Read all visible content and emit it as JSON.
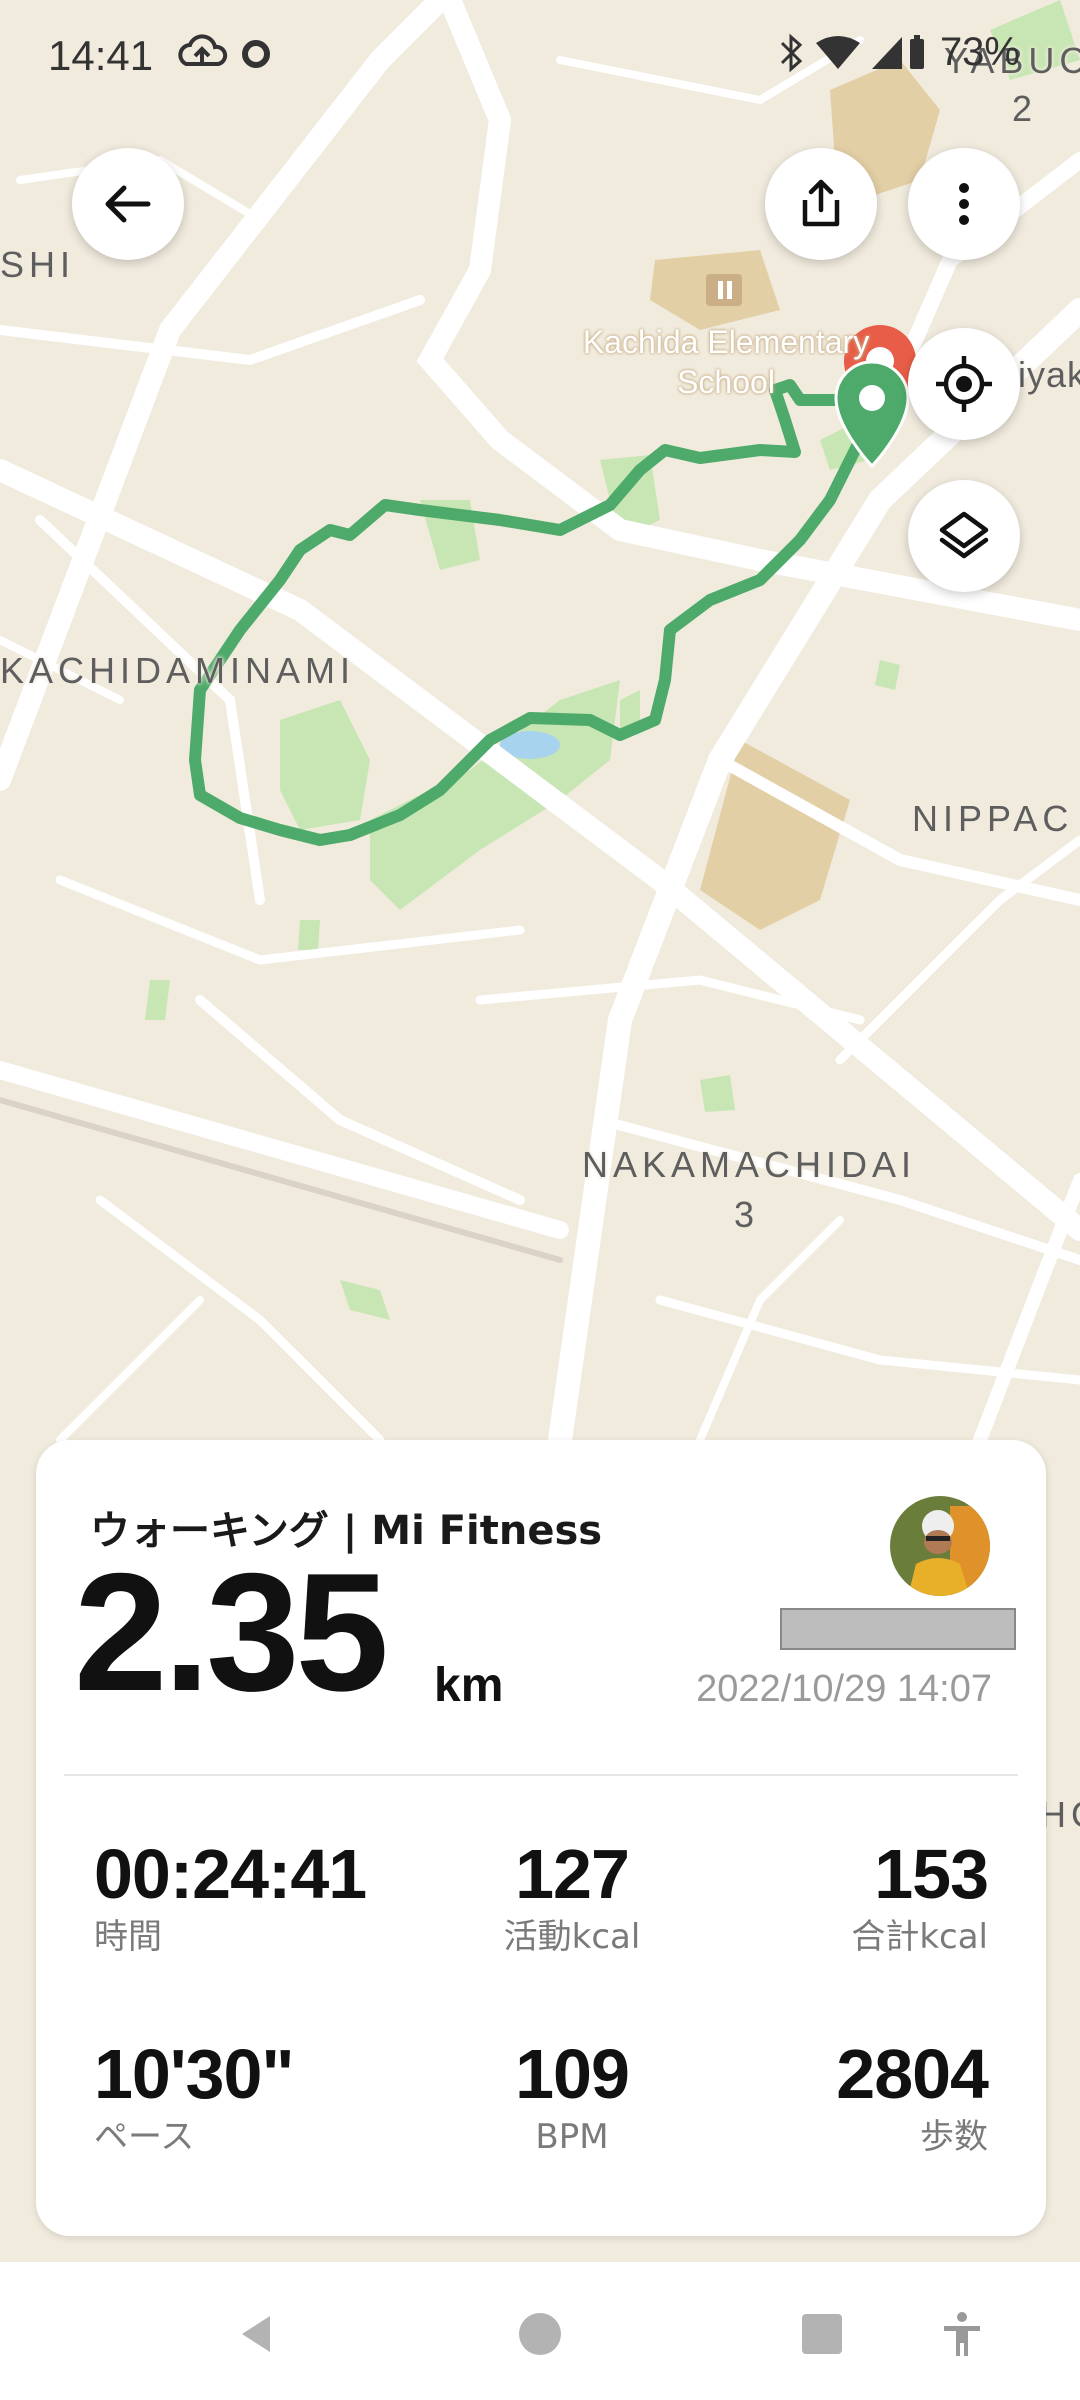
{
  "status_bar": {
    "time": "14:41",
    "battery": "73%",
    "icons": [
      "cloud-upload-icon",
      "record-icon",
      "bluetooth-icon",
      "wifi-icon",
      "signal-icon",
      "battery-icon"
    ]
  },
  "map": {
    "labels": {
      "kachidaminami": "KACHIDAMINAMI",
      "shi": "SHI",
      "nippac": "NIPPAC",
      "nakamachidai": "NAKAMACHIDAI",
      "nakamachidai_num": "3",
      "yabuc": "YABUC",
      "yabuc_num": "2",
      "iyak": "iyak",
      "school_line1": "Kachida Elementary",
      "school_line2": "School",
      "right_edge": "HC"
    },
    "colors": {
      "route": "#4eaa6a",
      "background": "#f1ebde",
      "park": "#c8e6b4",
      "school": "#e3cfa5"
    }
  },
  "buttons": {
    "back_icon": "arrow-left-icon",
    "share_icon": "share-icon",
    "more_icon": "more-vert-icon",
    "locate_icon": "crosshair-icon",
    "layers_icon": "layers-icon"
  },
  "card": {
    "title": "ウォーキング | Mi Fitness",
    "distance": "2.35",
    "unit": "km",
    "datetime": "2022/10/29 14:07",
    "stats": [
      {
        "value": "00:24:41",
        "label": "時間"
      },
      {
        "value": "127",
        "label": "活動kcal"
      },
      {
        "value": "153",
        "label": "合計kcal"
      },
      {
        "value": "10'30\"",
        "label": "ペース"
      },
      {
        "value": "109",
        "label": "BPM"
      },
      {
        "value": "2804",
        "label": "歩数"
      }
    ]
  },
  "nav": {
    "icons": [
      "back-triangle-icon",
      "home-circle-icon",
      "recents-square-icon",
      "accessibility-icon"
    ]
  }
}
